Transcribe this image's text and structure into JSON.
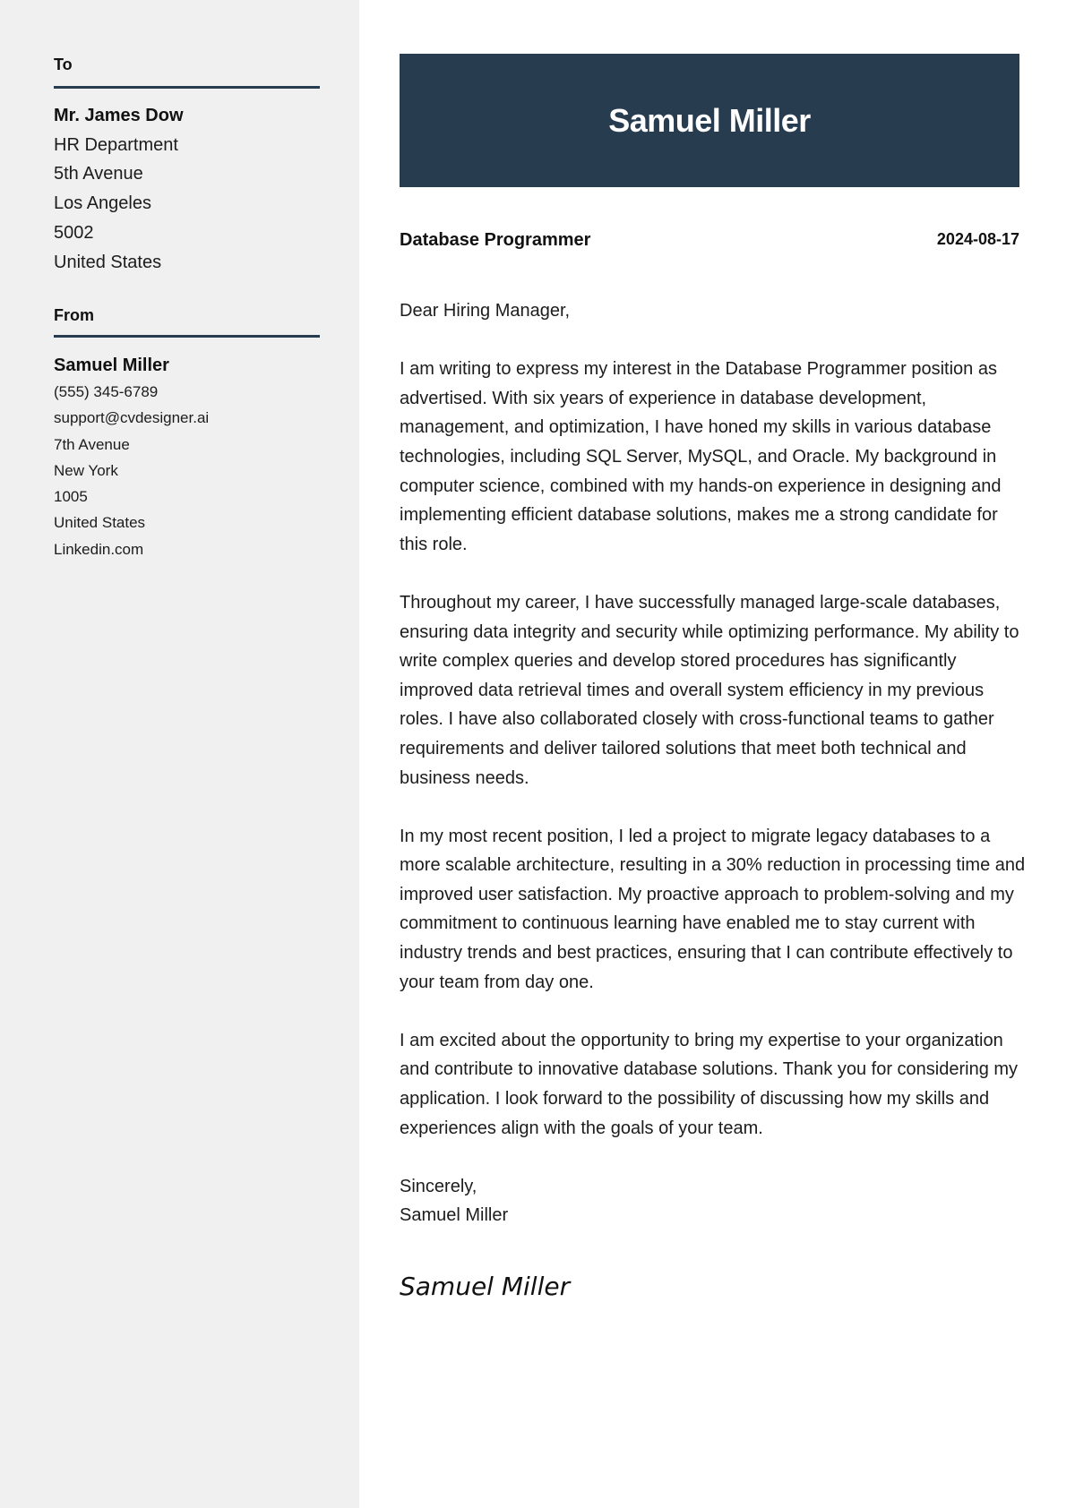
{
  "colors": {
    "sidebar_bg": "#f0f0f0",
    "accent": "#283c50",
    "header_text": "#ffffff"
  },
  "sidebar": {
    "to": {
      "title": "To",
      "name": "Mr. James Dow",
      "lines": [
        "HR Department",
        "5th Avenue",
        "Los Angeles",
        "5002",
        "United States"
      ]
    },
    "from": {
      "title": "From",
      "name": "Samuel Miller",
      "phone": "(555) 345-6789",
      "email": "support@cvdesigner.ai",
      "street": "7th Avenue",
      "city": "New York",
      "zip": "1005",
      "country": "United States",
      "website": "Linkedin.com"
    }
  },
  "header": {
    "name": "Samuel Miller"
  },
  "meta": {
    "job_title": "Database Programmer",
    "date": "2024-08-17"
  },
  "letter": {
    "salutation": "Dear Hiring Manager,",
    "paragraphs": [
      "I am writing to express my interest in the Database Programmer position as advertised. With six years of experience in database development, management, and optimization, I have honed my skills in various database technologies, including SQL Server, MySQL, and Oracle. My background in computer science, combined with my hands-on experience in designing and implementing efficient database solutions, makes me a strong candidate for this role.",
      "Throughout my career, I have successfully managed large-scale databases, ensuring data integrity and security while optimizing performance. My ability to write complex queries and develop stored procedures has significantly improved data retrieval times and overall system efficiency in my previous roles. I have also collaborated closely with cross-functional teams to gather requirements and deliver tailored solutions that meet both technical and business needs.",
      "In my most recent position, I led a project to migrate legacy databases to a more scalable architecture, resulting in a 30% reduction in processing time and improved user satisfaction. My proactive approach to problem-solving and my commitment to continuous learning have enabled me to stay current with industry trends and best practices, ensuring that I can contribute effectively to your team from day one.",
      "I am excited about the opportunity to bring my expertise to your organization and contribute to innovative database solutions. Thank you for considering my application. I look forward to the possibility of discussing how my skills and experiences align with the goals of your team."
    ],
    "closing": "Sincerely,",
    "closing_name": "Samuel Miller",
    "signature": "Samuel Miller"
  }
}
